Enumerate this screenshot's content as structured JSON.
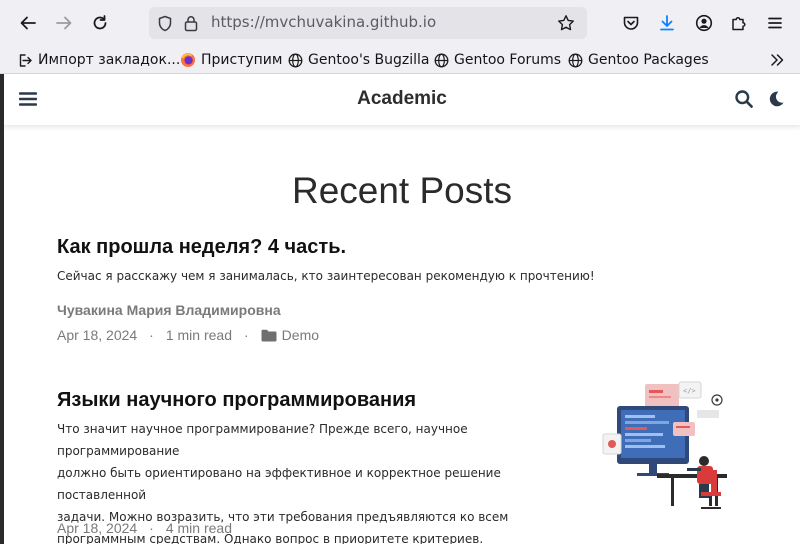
{
  "browser": {
    "url": "https://mvchuvakina.github.io",
    "bookmarks": [
      {
        "label": "Импорт закладок...",
        "icon": "import-icon"
      },
      {
        "label": "Приступим",
        "icon": "firefox-icon"
      },
      {
        "label": "Gentoo's Bugzilla",
        "icon": "globe-icon"
      },
      {
        "label": "Gentoo Forums",
        "icon": "globe-icon"
      },
      {
        "label": "Gentoo Packages",
        "icon": "globe-icon"
      }
    ]
  },
  "site": {
    "brand": "Academic"
  },
  "main": {
    "title": "Recent Posts",
    "posts": [
      {
        "title": "Как прошла неделя? 4 часть.",
        "summary": "Сейчас я расскажу чем я занималась, кто заинтересован рекомендую к прочтению!",
        "author": "Чувакина Мария Владимировна",
        "date": "Apr 18, 2024",
        "read_time": "1 min read",
        "category": "Demo"
      },
      {
        "title": "Языки научного программирования",
        "summary_lines": [
          "Что значит научное программирование? Прежде всего, научное программирование",
          "должно быть ориентировано на эффективное и корректное решение поставленной",
          "задачи. Можно возразить, что эти требования предъявляются ко всем",
          "программным средствам. Однако вопрос в приоритете критериев."
        ],
        "date": "Apr 18, 2024",
        "read_time": "4 min read"
      }
    ]
  },
  "colors": {
    "toolbar_bg": "#f0f0f4",
    "accent_blue": "#0a84ff",
    "text_muted": "#7a7a7a"
  }
}
